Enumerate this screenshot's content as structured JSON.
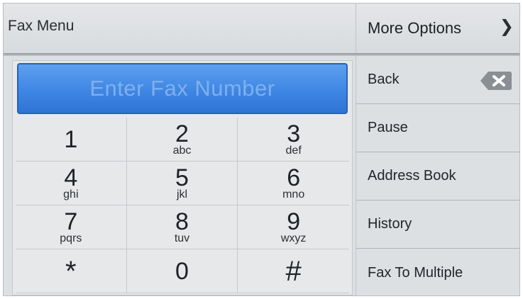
{
  "header": {
    "title": "Fax Menu",
    "more_options": "More Options",
    "more_options_icon": "chevron-right-icon"
  },
  "fax_input": {
    "placeholder": "Enter Fax Number",
    "value": ""
  },
  "keypad": [
    {
      "digit": "1",
      "letters": ""
    },
    {
      "digit": "2",
      "letters": "abc"
    },
    {
      "digit": "3",
      "letters": "def"
    },
    {
      "digit": "4",
      "letters": "ghi"
    },
    {
      "digit": "5",
      "letters": "jkl"
    },
    {
      "digit": "6",
      "letters": "mno"
    },
    {
      "digit": "7",
      "letters": "pqrs"
    },
    {
      "digit": "8",
      "letters": "tuv"
    },
    {
      "digit": "9",
      "letters": "wxyz"
    },
    {
      "digit": "*",
      "letters": ""
    },
    {
      "digit": "0",
      "letters": ""
    },
    {
      "digit": "#",
      "letters": ""
    }
  ],
  "side": {
    "back": "Back",
    "back_icon": "backspace-icon",
    "pause": "Pause",
    "address_book": "Address Book",
    "history": "History",
    "fax_to_multiple": "Fax To Multiple"
  },
  "colors": {
    "field_blue": "#3f86e4",
    "panel": "#dde0e3"
  }
}
